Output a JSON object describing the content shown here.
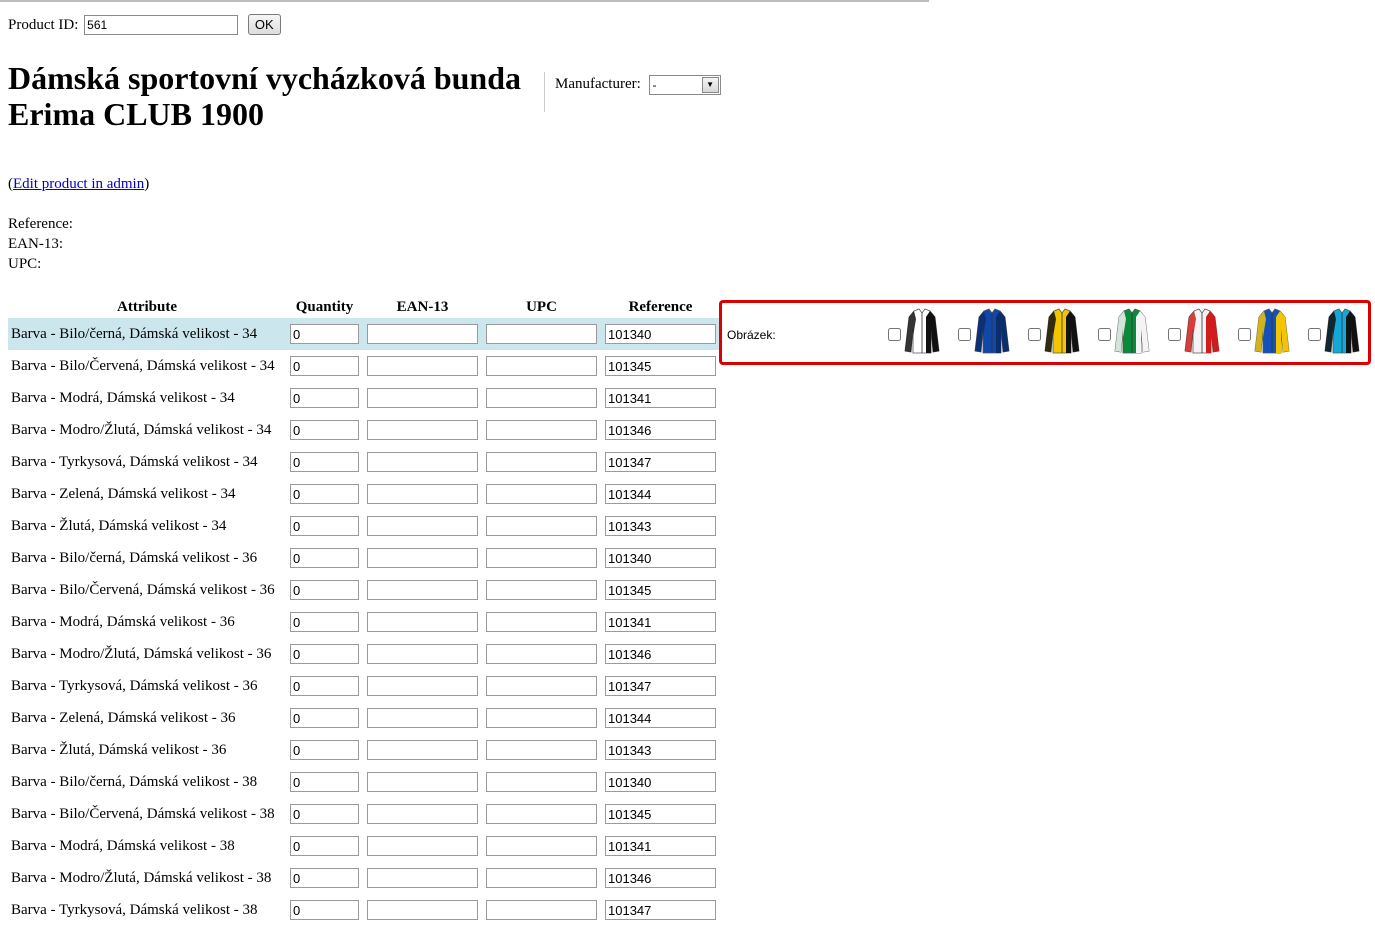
{
  "product_id": {
    "label": "Product ID:",
    "value": "561",
    "ok_label": "OK"
  },
  "title": "Dámská sportovní vycházková bunda Erima CLUB 1900",
  "manufacturer": {
    "label": "Manufacturer:",
    "value": "-"
  },
  "edit": {
    "open": "(",
    "link": "Edit product in admin",
    "close": ")"
  },
  "meta": {
    "reference": "Reference:",
    "ean": "EAN-13:",
    "upc": "UPC:"
  },
  "table": {
    "headers": [
      "Attribute",
      "Quantity",
      "EAN-13",
      "UPC",
      "Reference"
    ],
    "rows": [
      {
        "attr": "Barva - Bilo/černá, Dámská velikost - 34",
        "qty": "0",
        "ean": "",
        "upc": "",
        "ref": "101340"
      },
      {
        "attr": "Barva - Bilo/Červená, Dámská velikost - 34",
        "qty": "0",
        "ean": "",
        "upc": "",
        "ref": "101345"
      },
      {
        "attr": "Barva - Modrá, Dámská velikost - 34",
        "qty": "0",
        "ean": "",
        "upc": "",
        "ref": "101341"
      },
      {
        "attr": "Barva - Modro/Žlutá, Dámská velikost - 34",
        "qty": "0",
        "ean": "",
        "upc": "",
        "ref": "101346"
      },
      {
        "attr": "Barva - Tyrkysová, Dámská velikost - 34",
        "qty": "0",
        "ean": "",
        "upc": "",
        "ref": "101347"
      },
      {
        "attr": "Barva - Zelená, Dámská velikost - 34",
        "qty": "0",
        "ean": "",
        "upc": "",
        "ref": "101344"
      },
      {
        "attr": "Barva - Žlutá, Dámská velikost - 34",
        "qty": "0",
        "ean": "",
        "upc": "",
        "ref": "101343"
      },
      {
        "attr": "Barva - Bilo/černá, Dámská velikost - 36",
        "qty": "0",
        "ean": "",
        "upc": "",
        "ref": "101340"
      },
      {
        "attr": "Barva - Bilo/Červená, Dámská velikost - 36",
        "qty": "0",
        "ean": "",
        "upc": "",
        "ref": "101345"
      },
      {
        "attr": "Barva - Modrá, Dámská velikost - 36",
        "qty": "0",
        "ean": "",
        "upc": "",
        "ref": "101341"
      },
      {
        "attr": "Barva - Modro/Žlutá, Dámská velikost - 36",
        "qty": "0",
        "ean": "",
        "upc": "",
        "ref": "101346"
      },
      {
        "attr": "Barva - Tyrkysová, Dámská velikost - 36",
        "qty": "0",
        "ean": "",
        "upc": "",
        "ref": "101347"
      },
      {
        "attr": "Barva - Zelená, Dámská velikost - 36",
        "qty": "0",
        "ean": "",
        "upc": "",
        "ref": "101344"
      },
      {
        "attr": "Barva - Žlutá, Dámská velikost - 36",
        "qty": "0",
        "ean": "",
        "upc": "",
        "ref": "101343"
      },
      {
        "attr": "Barva - Bilo/černá, Dámská velikost - 38",
        "qty": "0",
        "ean": "",
        "upc": "",
        "ref": "101340"
      },
      {
        "attr": "Barva - Bilo/Červená, Dámská velikost - 38",
        "qty": "0",
        "ean": "",
        "upc": "",
        "ref": "101345"
      },
      {
        "attr": "Barva - Modrá, Dámská velikost - 38",
        "qty": "0",
        "ean": "",
        "upc": "",
        "ref": "101341"
      },
      {
        "attr": "Barva - Modro/Žlutá, Dámská velikost - 38",
        "qty": "0",
        "ean": "",
        "upc": "",
        "ref": "101346"
      },
      {
        "attr": "Barva - Tyrkysová, Dámská velikost - 38",
        "qty": "0",
        "ean": "",
        "upc": "",
        "ref": "101347"
      }
    ]
  },
  "images": {
    "label": "Obrázek:",
    "jackets": [
      {
        "icon": "jacket-white-black-icon",
        "body": "#ffffff",
        "side": "#111111",
        "checked": false
      },
      {
        "icon": "jacket-blue-icon",
        "body": "#1148a8",
        "side": "#0b2d6b",
        "checked": false
      },
      {
        "icon": "jacket-yellow-black-icon",
        "body": "#f2c500",
        "side": "#111111",
        "checked": false
      },
      {
        "icon": "jacket-green-white-icon",
        "body": "#0b8a3c",
        "side": "#f4f4f4",
        "checked": false
      },
      {
        "icon": "jacket-white-red-icon",
        "body": "#f4f4f4",
        "side": "#d01c1c",
        "checked": false
      },
      {
        "icon": "jacket-blue-yellow-icon",
        "body": "#1452b8",
        "side": "#f2c500",
        "checked": false
      },
      {
        "icon": "jacket-turquoise-black-icon",
        "body": "#14a8d8",
        "side": "#111111",
        "checked": false
      }
    ]
  },
  "colors": {
    "highlight_row": "#cbe6ec",
    "image_box_border": "#dd0000",
    "link": "#0000cc"
  }
}
